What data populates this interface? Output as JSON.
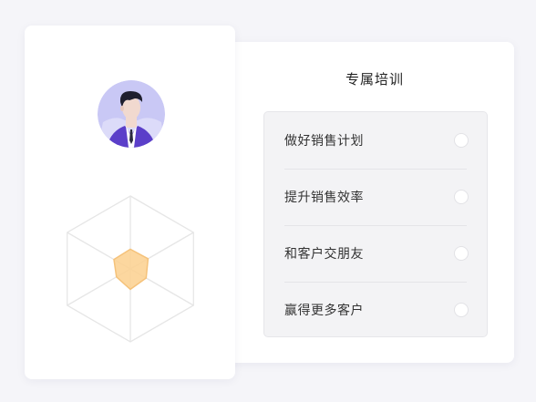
{
  "training": {
    "title": "专属培训",
    "items": [
      {
        "label": "做好销售计划",
        "checked": false
      },
      {
        "label": "提升销售效率",
        "checked": false
      },
      {
        "label": "和客户交朋友",
        "checked": false
      },
      {
        "label": "赢得更多客户",
        "checked": false
      }
    ]
  },
  "profile": {
    "avatar_icon": "user-avatar-icon",
    "radar_chart": {
      "axes": 6,
      "fill_color": "#fbd08e",
      "stroke_color": "#f5c27a",
      "grid_color": "#e6e6e6"
    }
  }
}
